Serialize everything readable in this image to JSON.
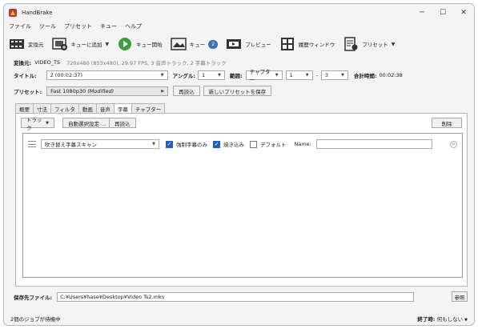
{
  "window": {
    "title": "HandBrake",
    "controls": {
      "minimize": "─",
      "maximize": "☐",
      "close": "✕"
    }
  },
  "menu": [
    "ファイル",
    "ツール",
    "プリセット",
    "キュー",
    "ヘルプ"
  ],
  "toolbar": {
    "convert": "変換元",
    "add_queue": "キューに追加",
    "start_queue": "キュー開始",
    "queue": "キュー",
    "queue_count": "2",
    "preview": "プレビュー",
    "activity": "履歴ウィンドウ",
    "presets": "プリセット"
  },
  "source": {
    "label": "変換元:",
    "name": "VIDEO_TS",
    "info": "720x480 (853x480), 29.97 FPS, 3 音声トラック, 2 字幕トラック"
  },
  "title_row": {
    "title_label": "タイトル:",
    "title_value": "2 (00:02:37)",
    "angle_label": "アングル:",
    "angle_value": "1",
    "range_label": "範囲:",
    "range_type": "チャプター",
    "range_start": "1",
    "range_sep": "-",
    "range_end": "3",
    "duration_label": "合計時間:",
    "duration_value": "00:02:38"
  },
  "preset_row": {
    "label": "プリセット:",
    "value": "Fast 1080p30",
    "modified": "(Modified)",
    "reload": "再読込",
    "save_new": "新しいプリセットを保存"
  },
  "tabs": [
    "概要",
    "寸法",
    "フィルタ",
    "動画",
    "音声",
    "字幕",
    "チャプター"
  ],
  "active_tab": "字幕",
  "subtitles": {
    "tracks_btn": "トラック",
    "auto_select_btn": "自動選択設定 ...",
    "reload_btn": "再読込",
    "remove_btn": "削除",
    "row": {
      "track": "吹き替え字幕スキャン",
      "forced": "強制字幕のみ",
      "burn": "焼き込み",
      "default": "デフォルト",
      "name_label": "Name:",
      "name_value": ""
    }
  },
  "destination": {
    "label": "保存先ファイル:",
    "path": "C:¥Users¥hase¥Desktop¥Video Ts2.mkv",
    "browse": "参照"
  },
  "status": {
    "left": "2個のジョブが待機中",
    "right_label": "終了時:",
    "right_value": "何もしない"
  },
  "colors": {
    "accent": "#1f5fbf",
    "badge": "#3a6fb5",
    "start_green": "#3aa03a"
  }
}
